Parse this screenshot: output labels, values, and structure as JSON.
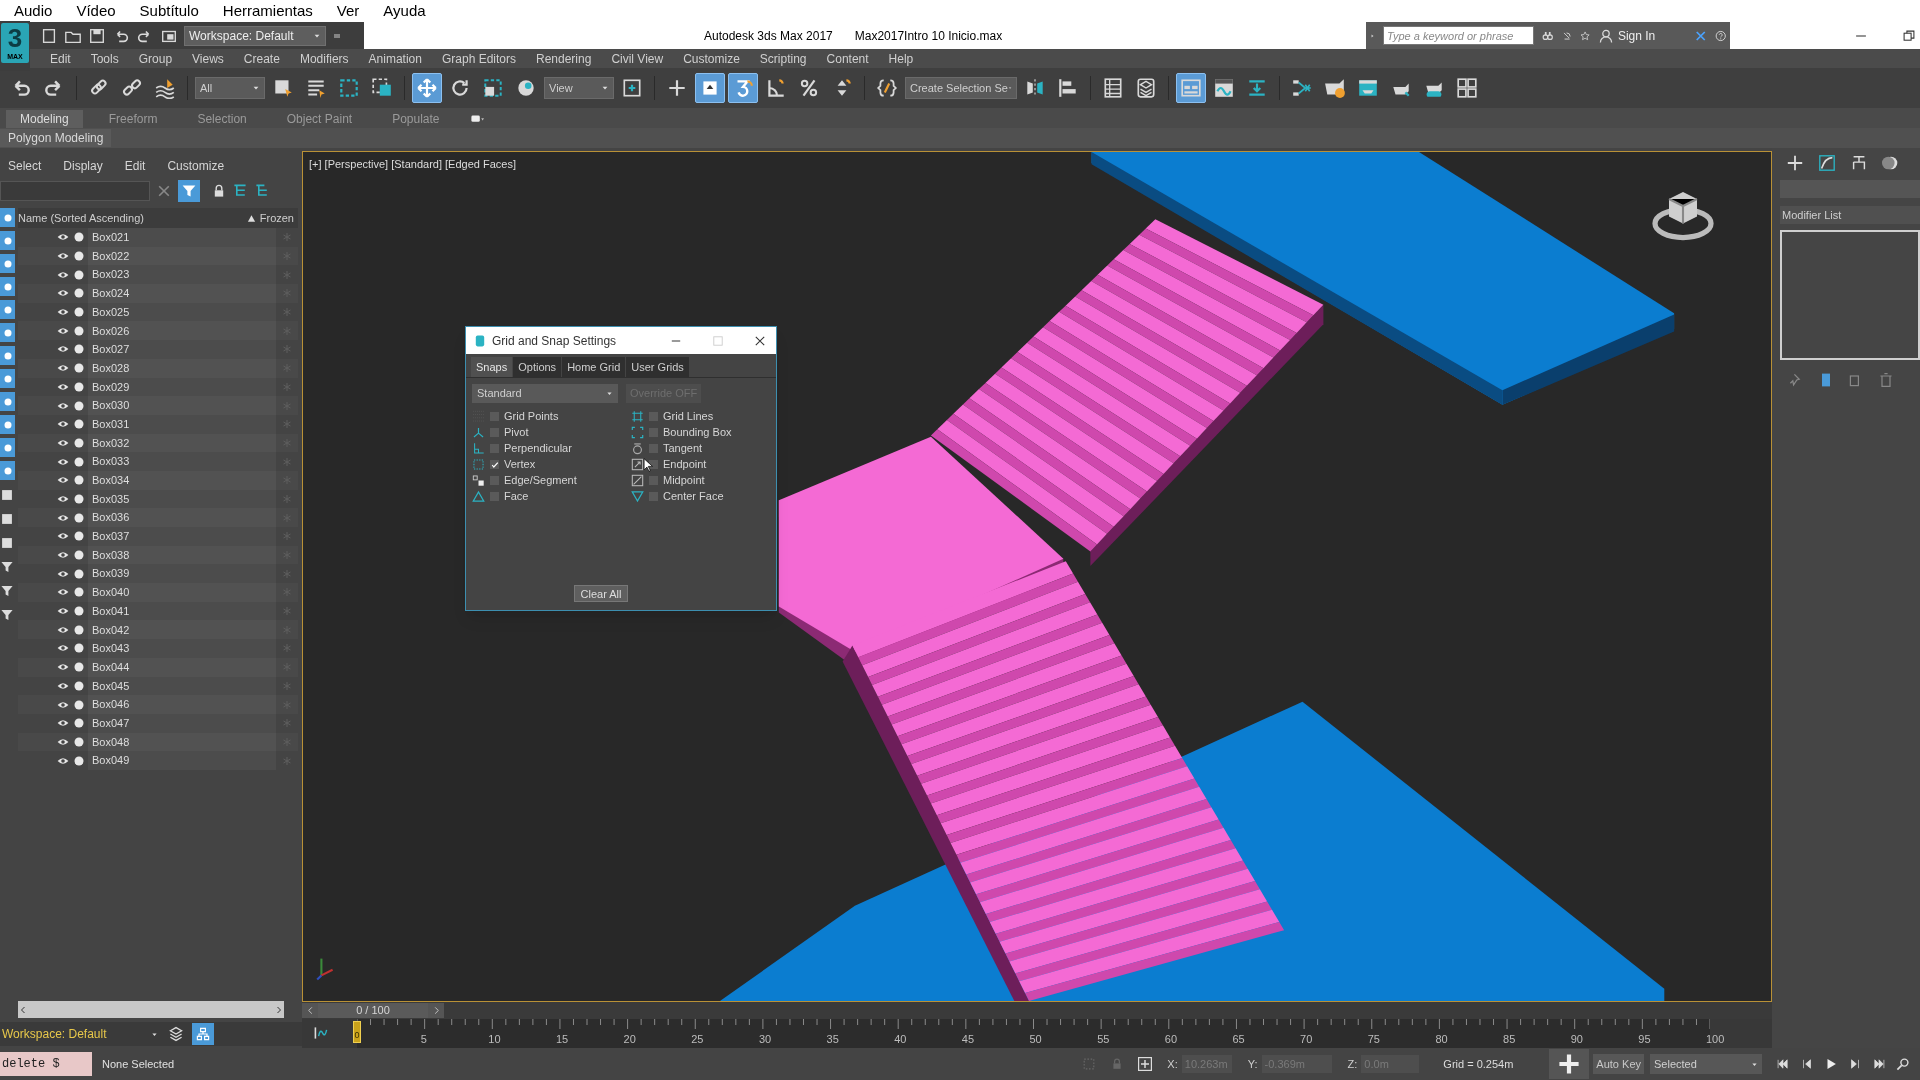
{
  "os_menu": [
    "Audio",
    "Vídeo",
    "Subtítulo",
    "Herramientas",
    "Ver",
    "Ayuda"
  ],
  "title_bar": {
    "logo": "3",
    "logo_caption": "MAX",
    "workspace": "Workspace: Default",
    "app_title": "Autodesk 3ds Max 2017",
    "file_name": "Max2017Intro 10 Inicio.max",
    "search_placeholder": "Type a keyword or phrase",
    "sign_in": "Sign In"
  },
  "menu": [
    "Edit",
    "Tools",
    "Group",
    "Views",
    "Create",
    "Modifiers",
    "Animation",
    "Graph Editors",
    "Rendering",
    "Civil View",
    "Customize",
    "Scripting",
    "Content",
    "Help"
  ],
  "toolbar": {
    "selection_filter": "All",
    "reference_coordinate": "View",
    "named_selection": "Create Selection Se",
    "buttons": [
      {
        "on": false
      },
      {
        "on": false
      },
      {
        "on": false
      },
      {
        "on": false
      },
      {
        "on": false
      },
      {
        "on": false
      },
      {
        "on": false
      },
      {
        "on": false
      },
      {
        "on": false
      },
      {
        "on": true
      },
      {
        "on": false
      },
      {
        "on": false
      },
      {
        "on": false
      },
      {
        "on": false
      },
      {
        "on": false
      },
      {
        "on": true
      },
      {
        "on": true
      },
      {
        "on": false
      },
      {
        "on": false
      },
      {
        "on": false
      },
      {
        "on": false
      },
      {
        "on": false
      },
      {
        "on": false
      },
      {
        "on": false
      },
      {
        "on": false
      },
      {
        "on": true
      },
      {
        "on": false
      },
      {
        "on": false
      },
      {
        "on": false
      },
      {
        "on": false
      },
      {
        "on": false
      },
      {
        "on": false
      },
      {
        "on": false
      },
      {
        "on": false
      }
    ]
  },
  "ribbon": {
    "tabs": [
      {
        "label": "Modeling",
        "selected": true
      },
      {
        "label": "Freeform",
        "selected": false
      },
      {
        "label": "Selection",
        "selected": false
      },
      {
        "label": "Object Paint",
        "selected": false
      },
      {
        "label": "Populate",
        "selected": false
      }
    ],
    "panel": "Polygon Modeling"
  },
  "scene_explorer": {
    "menu": [
      "Select",
      "Display",
      "Edit",
      "Customize"
    ],
    "filters": [
      {
        "on": true
      },
      {
        "on": true
      },
      {
        "on": true
      },
      {
        "on": true
      },
      {
        "on": true
      },
      {
        "on": true
      },
      {
        "on": true
      },
      {
        "on": true
      },
      {
        "on": true
      },
      {
        "on": true
      },
      {
        "on": true
      },
      {
        "on": true
      }
    ],
    "columns": [
      {
        "label": "Name (Sorted Ascending)",
        "sorted": false
      },
      {
        "label": "Frozen",
        "sorted": true
      }
    ],
    "rows": [
      "Box021",
      "Box022",
      "Box023",
      "Box024",
      "Box025",
      "Box026",
      "Box027",
      "Box028",
      "Box029",
      "Box030",
      "Box031",
      "Box032",
      "Box033",
      "Box034",
      "Box035",
      "Box036",
      "Box037",
      "Box038",
      "Box039",
      "Box040",
      "Box041",
      "Box042",
      "Box043",
      "Box044",
      "Box045",
      "Box046",
      "Box047",
      "Box048",
      "Box049"
    ],
    "workspace": "Workspace: Default"
  },
  "viewport": {
    "label": "[+] [Perspective] [Standard] [Edged Faces]"
  },
  "dialog": {
    "title": "Grid and Snap Settings",
    "tabs": [
      {
        "label": "Snaps",
        "selected": true
      },
      {
        "label": "Options",
        "selected": false
      },
      {
        "label": "Home Grid",
        "selected": false
      },
      {
        "label": "User Grids",
        "selected": false
      }
    ],
    "preset": "Standard",
    "override": "Override OFF",
    "override_disabled": true,
    "snaps": [
      {
        "label": "Grid Points",
        "checked": false
      },
      {
        "label": "Grid Lines",
        "checked": false
      },
      {
        "label": "Pivot",
        "checked": false
      },
      {
        "label": "Bounding Box",
        "checked": false
      },
      {
        "label": "Perpendicular",
        "checked": false
      },
      {
        "label": "Tangent",
        "checked": false
      },
      {
        "label": "Vertex",
        "checked": true
      },
      {
        "label": "Endpoint",
        "checked": false
      },
      {
        "label": "Edge/Segment",
        "checked": false
      },
      {
        "label": "Midpoint",
        "checked": false
      },
      {
        "label": "Face",
        "checked": false
      },
      {
        "label": "Center Face",
        "checked": false
      }
    ],
    "clear": "Clear All"
  },
  "command_panel": {
    "modifier_list": "Modifier List"
  },
  "time_slider": {
    "position": "0 / 100",
    "level": 0
  },
  "timeline": {
    "current_frame": "0",
    "labels": [
      "5",
      "10",
      "15",
      "20",
      "25",
      "30",
      "35",
      "40",
      "45",
      "50",
      "55",
      "60",
      "65",
      "70",
      "75",
      "80",
      "85",
      "90",
      "95",
      "100"
    ]
  },
  "status_bar": {
    "listener": "delete $",
    "prompt": "None Selected",
    "x_label": "X:",
    "x": "10.263m",
    "y_label": "Y:",
    "y": "-0.369m",
    "z_label": "Z:",
    "z": "0.0m",
    "grid": "Grid = 0.254m",
    "auto_key": "Auto Key",
    "key_filter": "Selected"
  }
}
